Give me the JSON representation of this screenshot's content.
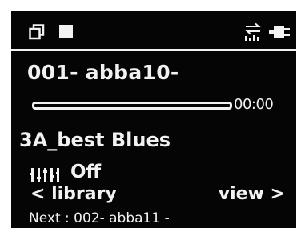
{
  "status_bar": {
    "icons": [
      "repeat-icon",
      "stop-icon",
      "equalizer-status-icon",
      "battery-icon"
    ]
  },
  "now_playing": {
    "track_title": "001- abba10-",
    "elapsed_time": "00:00",
    "progress_fraction": 0.0,
    "album_name": "3A_best Blues"
  },
  "equalizer": {
    "icon": "equalizer-icon",
    "value": "Off"
  },
  "navigation": {
    "left_label": "< library",
    "right_label": "view >"
  },
  "up_next": {
    "label": "Next : 002- abba11 -"
  },
  "colors": {
    "screen_background": "#050505",
    "foreground": "#f2f2f2"
  }
}
